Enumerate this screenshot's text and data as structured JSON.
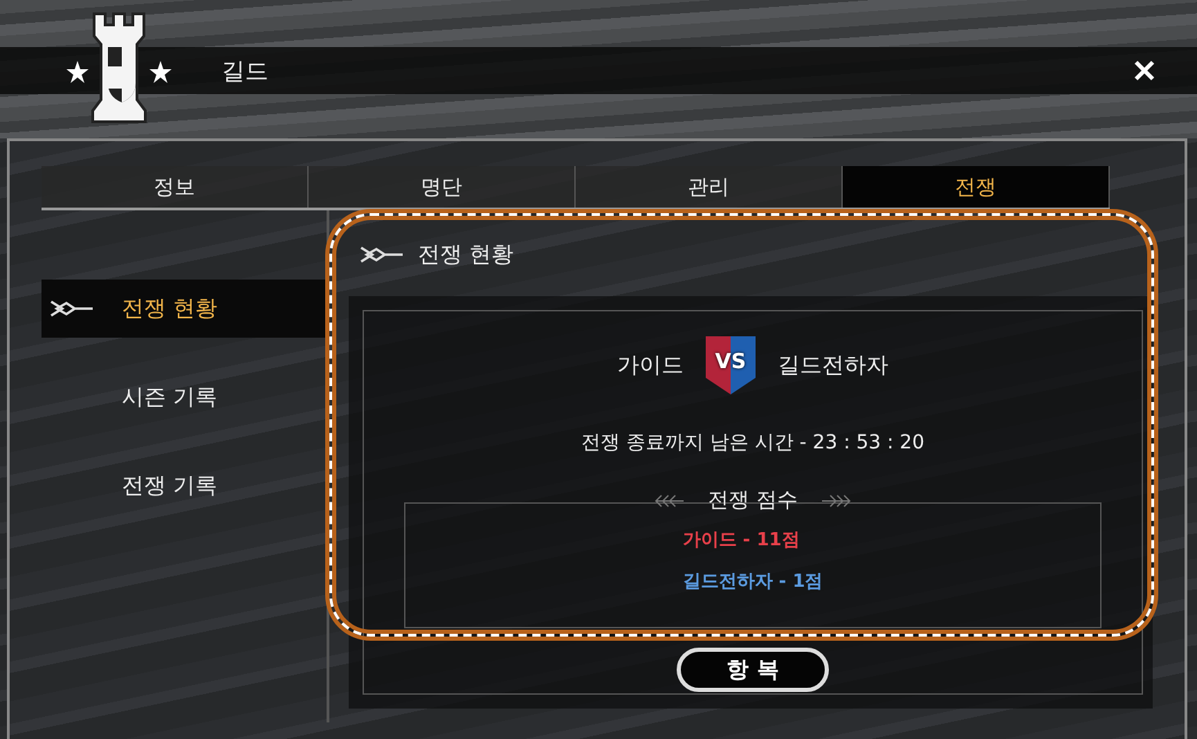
{
  "window": {
    "title": "길드"
  },
  "tabs": [
    {
      "label": "정보",
      "selected": false
    },
    {
      "label": "명단",
      "selected": false
    },
    {
      "label": "관리",
      "selected": false
    },
    {
      "label": "전쟁",
      "selected": true
    }
  ],
  "sidebar": {
    "items": [
      {
        "label": "전쟁 현황",
        "selected": true
      },
      {
        "label": "시즌 기록",
        "selected": false
      },
      {
        "label": "전쟁 기록",
        "selected": false
      }
    ]
  },
  "section": {
    "title": "전쟁 현황"
  },
  "war": {
    "home_guild": "가이드",
    "vs_badge": "VS",
    "away_guild": "길드전하자",
    "time_remaining": "전쟁 종료까지 남은 시간 - 23 : 53 : 20",
    "score_title": "전쟁 점수",
    "scores": [
      {
        "text": "가이드 - 11점",
        "color": "#e8404a"
      },
      {
        "text": "길드전하자 - 1점",
        "color": "#5b9be0"
      }
    ]
  },
  "surrender_button": "항 복"
}
